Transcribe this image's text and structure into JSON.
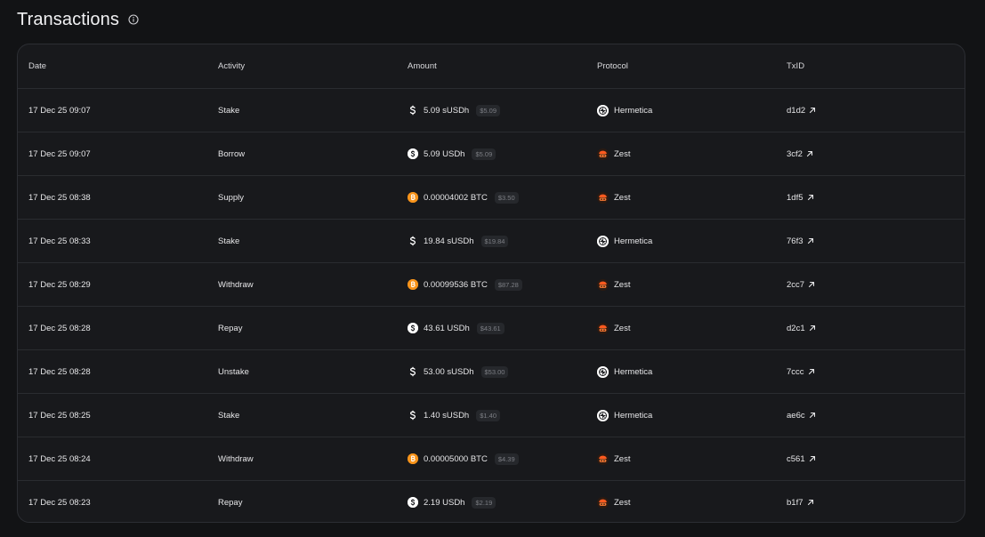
{
  "header": {
    "title": "Transactions",
    "info_icon": "info-circle-icon"
  },
  "columns": {
    "date": "Date",
    "activity": "Activity",
    "amount": "Amount",
    "protocol": "Protocol",
    "txid": "TxID"
  },
  "rows": [
    {
      "date": "17 Dec 25 09:07",
      "activity": "Stake",
      "amount": "5.09 sUSDh",
      "usd": "$5.09",
      "token_icon": "susdh-icon",
      "protocol": "Hermetica",
      "protocol_icon": "hermetica-logo-icon",
      "txid": "d1d2",
      "link_icon": "external-link-icon"
    },
    {
      "date": "17 Dec 25 09:07",
      "activity": "Borrow",
      "amount": "5.09 USDh",
      "usd": "$5.09",
      "token_icon": "usdh-icon",
      "protocol": "Zest",
      "protocol_icon": "zest-logo-icon",
      "txid": "3cf2",
      "link_icon": "external-link-icon"
    },
    {
      "date": "17 Dec 25 08:38",
      "activity": "Supply",
      "amount": "0.00004002 BTC",
      "usd": "$3.50",
      "token_icon": "btc-icon",
      "protocol": "Zest",
      "protocol_icon": "zest-logo-icon",
      "txid": "1df5",
      "link_icon": "external-link-icon"
    },
    {
      "date": "17 Dec 25 08:33",
      "activity": "Stake",
      "amount": "19.84 sUSDh",
      "usd": "$19.84",
      "token_icon": "susdh-icon",
      "protocol": "Hermetica",
      "protocol_icon": "hermetica-logo-icon",
      "txid": "76f3",
      "link_icon": "external-link-icon"
    },
    {
      "date": "17 Dec 25 08:29",
      "activity": "Withdraw",
      "amount": "0.00099536 BTC",
      "usd": "$87.28",
      "token_icon": "btc-icon",
      "protocol": "Zest",
      "protocol_icon": "zest-logo-icon",
      "txid": "2cc7",
      "link_icon": "external-link-icon"
    },
    {
      "date": "17 Dec 25 08:28",
      "activity": "Repay",
      "amount": "43.61 USDh",
      "usd": "$43.61",
      "token_icon": "usdh-icon",
      "protocol": "Zest",
      "protocol_icon": "zest-logo-icon",
      "txid": "d2c1",
      "link_icon": "external-link-icon"
    },
    {
      "date": "17 Dec 25 08:28",
      "activity": "Unstake",
      "amount": "53.00 sUSDh",
      "usd": "$53.00",
      "token_icon": "susdh-icon",
      "protocol": "Hermetica",
      "protocol_icon": "hermetica-logo-icon",
      "txid": "7ccc",
      "link_icon": "external-link-icon"
    },
    {
      "date": "17 Dec 25 08:25",
      "activity": "Stake",
      "amount": "1.40 sUSDh",
      "usd": "$1.40",
      "token_icon": "susdh-icon",
      "protocol": "Hermetica",
      "protocol_icon": "hermetica-logo-icon",
      "txid": "ae6c",
      "link_icon": "external-link-icon"
    },
    {
      "date": "17 Dec 25 08:24",
      "activity": "Withdraw",
      "amount": "0.00005000 BTC",
      "usd": "$4.39",
      "token_icon": "btc-icon",
      "protocol": "Zest",
      "protocol_icon": "zest-logo-icon",
      "txid": "c561",
      "link_icon": "external-link-icon"
    },
    {
      "date": "17 Dec 25 08:23",
      "activity": "Repay",
      "amount": "2.19 USDh",
      "usd": "$2.19",
      "token_icon": "usdh-icon",
      "protocol": "Zest",
      "protocol_icon": "zest-logo-icon",
      "txid": "b1f7",
      "link_icon": "external-link-icon"
    }
  ],
  "colors": {
    "background": "#121315",
    "table_bg": "#18191c",
    "border": "#2c2e33",
    "btc": "#f7931a",
    "zest": "#ff5a1f"
  }
}
